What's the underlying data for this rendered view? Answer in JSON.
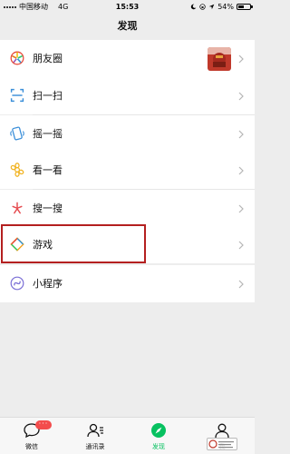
{
  "status_bar": {
    "carrier": "中国移动",
    "network": "4G",
    "time": "15:53",
    "battery": "54%",
    "battery_level": 0.54
  },
  "nav": {
    "title": "发现"
  },
  "menu": {
    "moments": "朋友圈",
    "scan": "扫一扫",
    "shake": "摇一摇",
    "top_stories": "看一看",
    "search": "搜一搜",
    "games": "游戏",
    "mini_programs": "小程序"
  },
  "tabs": {
    "chats": "微信",
    "chats_badge": "···",
    "contacts": "通讯录",
    "discover": "发现",
    "me": "我"
  },
  "colors": {
    "accent": "#07c160",
    "highlight_border": "#b42020",
    "badge": "#f34c4c"
  }
}
